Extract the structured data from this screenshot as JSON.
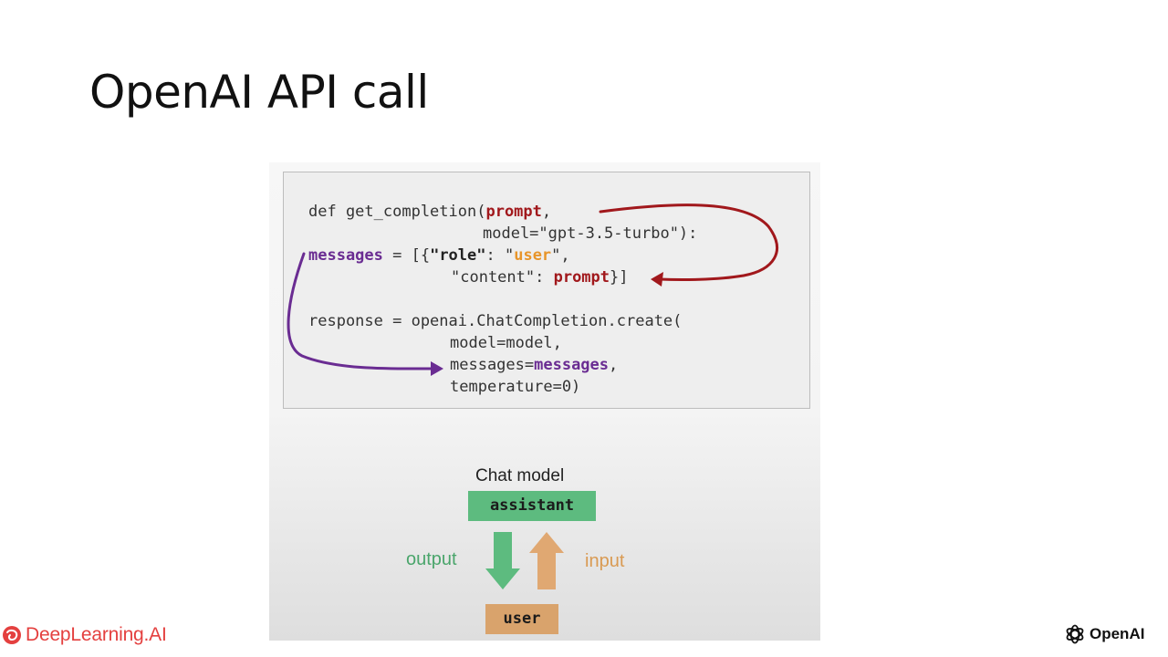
{
  "slide": {
    "title": "OpenAI API call"
  },
  "code": {
    "line1": {
      "a": "def get_completion(",
      "b": "prompt",
      "c": ","
    },
    "line2": {
      "a": "model=\"gpt-3.5-turbo\"):"
    },
    "line3": {
      "a": "messages",
      "b": " = [{",
      "c": "\"role\"",
      "d": ": \"",
      "e": "user",
      "f": "\","
    },
    "line4": {
      "a": "\"content\": ",
      "b": "prompt",
      "c": "}]"
    },
    "line5": {
      "a": "response = openai.ChatCompletion.create("
    },
    "line6": {
      "a": "model=model,"
    },
    "line7": {
      "a": "messages=",
      "b": "messages",
      "c": ","
    },
    "line8": {
      "a": "temperature=0)"
    }
  },
  "diagram": {
    "chat_model_label": "Chat model",
    "assistant_label": "assistant",
    "user_label": "user",
    "output_label": "output",
    "input_label": "input"
  },
  "footer": {
    "left_brand": "DeepLearning.AI",
    "right_brand": "OpenAI"
  },
  "colors": {
    "prompt_red": "#a1181c",
    "messages_purple": "#6a2c92",
    "user_orange": "#e8952a",
    "assistant_green": "#5dbb7f",
    "user_tan": "#d9a36c",
    "brand_red": "#e4403f"
  },
  "icons": {
    "left_logo": "deeplearning-ai-logo-icon",
    "right_logo": "openai-logo-icon"
  }
}
